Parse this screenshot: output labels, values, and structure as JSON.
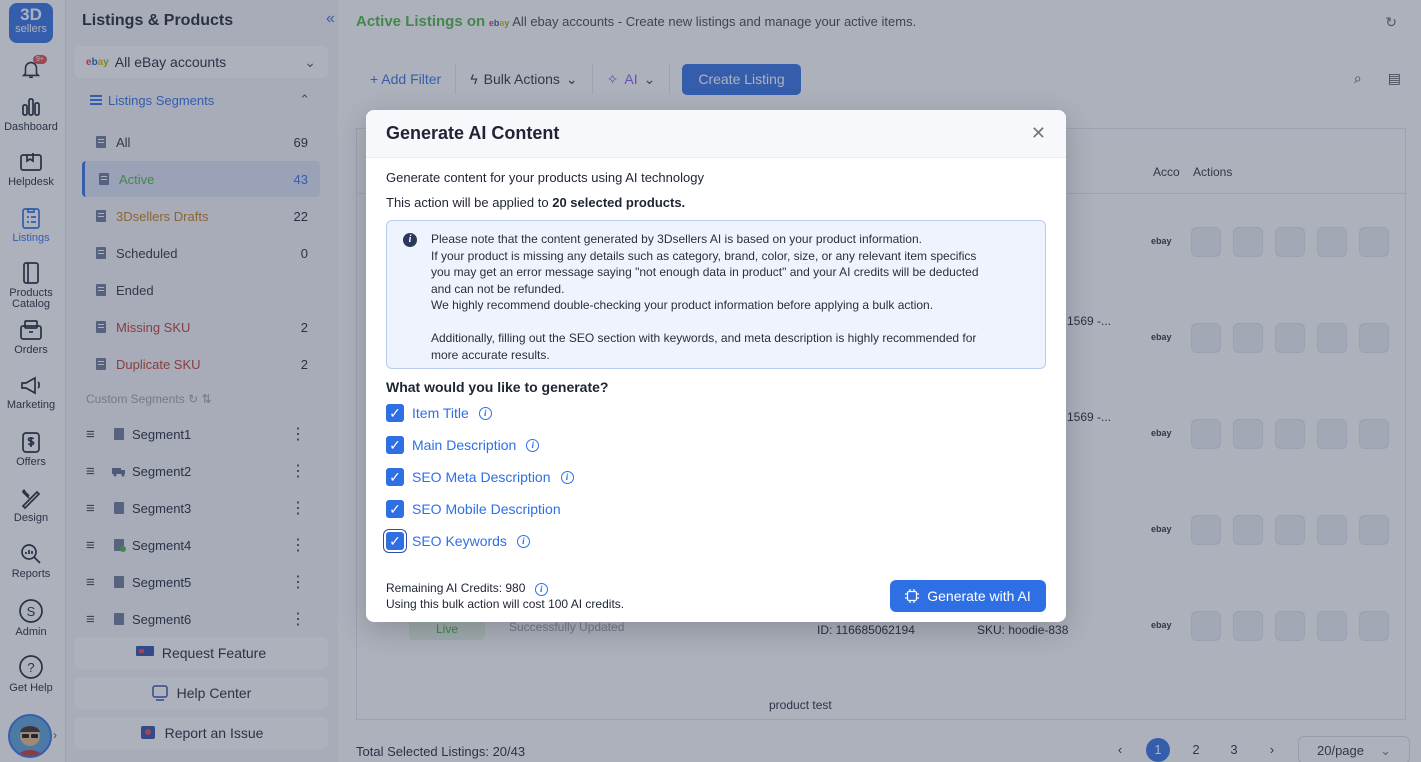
{
  "app": {
    "logo_line1": "3D",
    "logo_line2": "sellers",
    "notif_badge": "9+"
  },
  "rail": {
    "items": [
      {
        "label": "Dashboard"
      },
      {
        "label": "Helpdesk"
      },
      {
        "label": "Listings"
      },
      {
        "label": "Products Catalog"
      },
      {
        "label": "Orders"
      },
      {
        "label": "Marketing"
      },
      {
        "label": "Offers"
      },
      {
        "label": "Design"
      },
      {
        "label": "Reports"
      },
      {
        "label": "Admin"
      },
      {
        "label": "Get Help"
      }
    ]
  },
  "sidebar": {
    "title": "Listings & Products",
    "account_logo": "ebay",
    "account_selector": "All eBay accounts",
    "segments_header": "Listings Segments",
    "segments": [
      {
        "label": "All",
        "count": "69"
      },
      {
        "label": "Active",
        "count": "43"
      },
      {
        "label": "3Dsellers Drafts",
        "count": "22"
      },
      {
        "label": "Scheduled",
        "count": "0"
      },
      {
        "label": "Ended",
        "count": ""
      },
      {
        "label": "Missing SKU",
        "count": "2"
      },
      {
        "label": "Duplicate SKU",
        "count": "2"
      }
    ],
    "custom_header": "Custom Segments",
    "custom_segments": [
      {
        "label": "Segment1"
      },
      {
        "label": "Segment2"
      },
      {
        "label": "Segment3"
      },
      {
        "label": "Segment4"
      },
      {
        "label": "Segment5"
      },
      {
        "label": "Segment6"
      }
    ],
    "request_feature": "Request Feature",
    "help_center": "Help Center",
    "report_issue": "Report an Issue"
  },
  "main": {
    "title_green": "Active Listings on",
    "title_logo": "ebay",
    "title_rest": "All ebay accounts - Create new listings and manage your active items.",
    "toolbar": {
      "add_filter": "+ Add Filter",
      "bulk_actions": "Bulk Actions",
      "ai": "AI",
      "create_listing": "Create Listing"
    },
    "table": {
      "col_account": "Acco",
      "col_actions": "Actions",
      "row_logo": "ebay",
      "row_id_1": "1569 -...",
      "row_id_2": "1569 -...",
      "row_status": "Live",
      "row_status_text": "Successfully Updated",
      "row_item_id": "ID: 116685062194",
      "row_sku": "SKU: hoodie-838",
      "row_title_last": "product test"
    },
    "footer": {
      "selected": "Total Selected Listings: 20/43",
      "pages": [
        "1",
        "2",
        "3"
      ],
      "per_page": "20/page"
    }
  },
  "modal": {
    "title": "Generate AI Content",
    "subtitle": "Generate content for your products using AI technology",
    "applied_prefix": "This action will be applied to",
    "applied_count": "20 selected products.",
    "note_lines": [
      "Please note that the content generated by 3Dsellers AI is based on your product information.",
      "If your product is missing any details such as category, brand, color, size, or any relevant item specifics",
      "you may get an error message saying \"not enough data in product\" and your AI credits will be deducted",
      "and can not be refunded.",
      "We highly recommend double-checking your product information before applying a bulk action.",
      "",
      "Additionally, filling out the SEO section with keywords, and meta description is highly recommended for",
      "more accurate results."
    ],
    "question": "What would you like to generate?",
    "options": [
      {
        "label": "Item Title",
        "checked": true,
        "info": true
      },
      {
        "label": "Main Description",
        "checked": true,
        "info": true
      },
      {
        "label": "SEO Meta Description",
        "checked": true,
        "info": true
      },
      {
        "label": "SEO Mobile Description",
        "checked": true,
        "info": false
      },
      {
        "label": "SEO Keywords",
        "checked": true,
        "info": true
      }
    ],
    "credits_remaining": "Remaining AI Credits: 980",
    "credits_cost": "Using this bulk action will cost 100 AI credits.",
    "generate_button": "Generate with AI"
  },
  "colors": {
    "accent": "#2f6fe4",
    "green": "#4bb543",
    "warning": "#c77d10",
    "danger": "#c0392b"
  }
}
